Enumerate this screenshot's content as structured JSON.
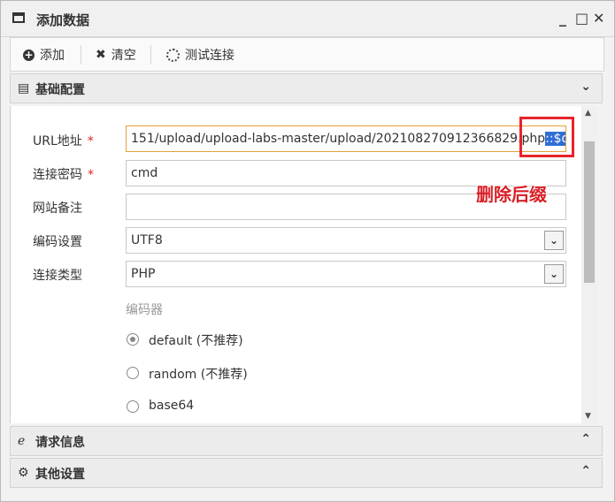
{
  "window": {
    "title": "添加数据"
  },
  "toolbar": {
    "add": "添加",
    "clear": "清空",
    "test": "测试连接"
  },
  "panels": {
    "basic": "基础配置",
    "request": "请求信息",
    "other": "其他设置"
  },
  "form": {
    "url_label": "URL地址",
    "url_value_plain": "151/upload/upload-labs-master/upload/202108270912366829.php",
    "url_value_selected": "::$data",
    "password_label": "连接密码",
    "password_value": "cmd",
    "note_label": "网站备注",
    "note_value": "",
    "encoding_label": "编码设置",
    "encoding_value": "UTF8",
    "type_label": "连接类型",
    "type_value": "PHP",
    "encoder_title": "编码器",
    "encoders": [
      "default (不推荐)",
      "random (不推荐)",
      "base64"
    ],
    "required_mark": "*"
  },
  "annotation": "删除后缀",
  "icons": {
    "window": "window-icon",
    "add": "plus-circle-icon",
    "clear": "x-icon",
    "test": "spinner-icon"
  }
}
